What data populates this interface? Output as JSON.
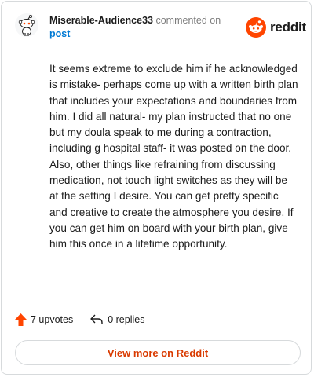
{
  "header": {
    "username": "Miserable-Audience33",
    "action_text": "commented on",
    "post_link": "post",
    "logo_text": "reddit"
  },
  "comment": {
    "body": "It seems extreme to exclude him if he acknowledged is mistake- perhaps come up with a written birth plan that includes your expectations and boundaries from him. I did all natural- my plan instructed that no one but my doula speak to me during a contraction, including g hospital staff- it was posted on the door. Also, other things like refraining from discussing medication, not touch light switches as they will be at the setting I desire. You can get pretty specific and creative to create the atmosphere you desire. If you can get him on board with your birth plan, give him this once in a lifetime opportunity."
  },
  "footer": {
    "upvotes": "7 upvotes",
    "replies": "0 replies",
    "view_more": "View more on Reddit"
  },
  "colors": {
    "brand_orange": "#ff4500",
    "link_blue": "#0079d3",
    "button_text": "#d93a00"
  },
  "icons": {
    "avatar": "snoo-avatar-icon",
    "logo": "reddit-logo-icon",
    "upvote": "upvote-arrow-icon",
    "reply": "reply-arrow-icon"
  }
}
